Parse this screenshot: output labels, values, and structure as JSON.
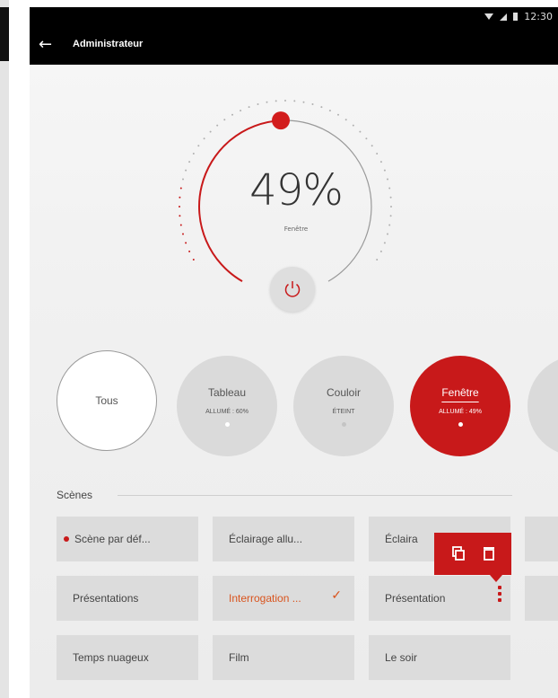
{
  "status_bar": {
    "time": "12:30"
  },
  "app_bar": {
    "title": "Administrateur"
  },
  "dial": {
    "percent_text": "49%",
    "value": 49,
    "label": "Fenêtre"
  },
  "zones": [
    {
      "name": "Tous",
      "state": ""
    },
    {
      "name": "Tableau",
      "state": "ALLUMÉ : 60%"
    },
    {
      "name": "Couloir",
      "state": "ÉTEINT"
    },
    {
      "name": "Fenêtre",
      "state": "ALLUMÉ : 49%",
      "active": true
    }
  ],
  "scenes": {
    "title": "Scènes",
    "tiles": [
      {
        "label": "Scène par déf...",
        "default": true
      },
      {
        "label": "Éclairage allu..."
      },
      {
        "label": "Éclaira"
      },
      {
        "label": "Présentations"
      },
      {
        "label": "Interrogation ...",
        "selected": true
      },
      {
        "label": "Présentation"
      },
      {
        "label": "Temps nuageux"
      },
      {
        "label": "Film"
      },
      {
        "label": "Le soir"
      }
    ]
  },
  "colors": {
    "accent": "#c8191a",
    "selected_text": "#d9541e",
    "tile_bg": "#dcdcdc"
  },
  "icons": [
    "back-arrow-icon",
    "wifi-icon",
    "signal-icon",
    "battery-icon",
    "power-icon",
    "copy-icon",
    "delete-icon",
    "more-vertical-icon",
    "check-icon"
  ]
}
